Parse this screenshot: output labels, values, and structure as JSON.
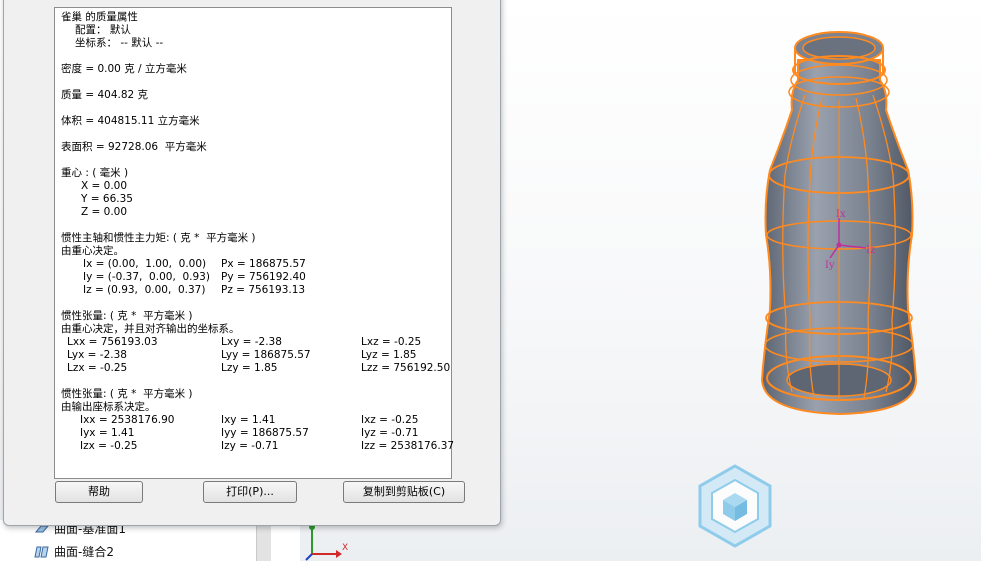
{
  "report": {
    "title": "雀巢 的质量属性",
    "config": "配置： 默认",
    "coord": "坐标系： -- 默认 --",
    "density": "密度 = 0.00 克 / 立方毫米",
    "mass": "质量 = 404.82 克",
    "volume": "体积 = 404815.11 立方毫米",
    "area": "表面积 = 92728.06  平方毫米",
    "cog_title": "重心 : ( 毫米 )",
    "cog_x": "X = 0.00",
    "cog_y": "Y = 66.35",
    "cog_z": "Z = 0.00",
    "principal_title": "惯性主轴和惯性主力矩: ( 克 *  平方毫米 )",
    "principal_sub": "由重心决定。",
    "ix": "Ix = (0.00,  1.00,  0.00)",
    "iy": "Iy = (-0.37,  0.00,  0.93)",
    "iz": "Iz = (0.93,  0.00,  0.37)",
    "px": "Px = 186875.57",
    "py": "Py = 756192.40",
    "pz": "Pz = 756193.13",
    "tensor1_title": "惯性张量: ( 克 *  平方毫米 )",
    "tensor1_sub": "由重心决定，并且对齐输出的坐标系。",
    "lxx": "Lxx = 756193.03",
    "lxy": "Lxy = -2.38",
    "lxz": "Lxz = -0.25",
    "lyx": "Lyx = -2.38",
    "lyy": "Lyy = 186875.57",
    "lyz": "Lyz = 1.85",
    "lzx": "Lzx = -0.25",
    "lzy": "Lzy = 1.85",
    "lzz": "Lzz = 756192.50",
    "tensor2_title": "惯性张量: ( 克 *  平方毫米 )",
    "tensor2_sub": "由输出座标系决定。",
    "ixx": "Ixx = 2538176.90",
    "ixy": "Ixy = 1.41",
    "ixz": "Ixz = -0.25",
    "iyx": "Iyx = 1.41",
    "iyy": "Iyy = 186875.57",
    "iyz": "Iyz = -0.71",
    "izx": "Izx = -0.25",
    "izy": "Izy = -0.71",
    "izz": "Izz = 2538176.37"
  },
  "buttons": {
    "help": "帮助",
    "print": "打印(P)...",
    "copy": "复制到剪贴板(C)"
  },
  "tree": {
    "item1": "曲面-基准面1",
    "item2": "曲面-缝合2"
  },
  "triad": {
    "x_label": "X"
  },
  "model": {
    "axis_ix": "Ix",
    "axis_iy": "Iy",
    "axis_iz": "Iz"
  },
  "colors": {
    "model_edge": "#ff8a1f",
    "model_body": "#7b8392",
    "axis_marker": "#c0309a",
    "logo": "#7fc6ea"
  }
}
